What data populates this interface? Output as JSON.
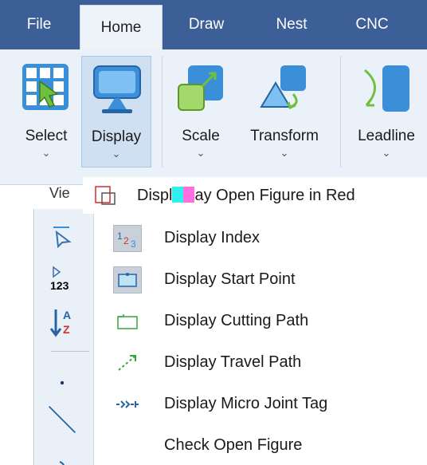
{
  "tabs": [
    {
      "label": "File",
      "active": false
    },
    {
      "label": "Home",
      "active": true
    },
    {
      "label": "Draw",
      "active": false
    },
    {
      "label": "Nest",
      "active": false
    },
    {
      "label": "CNC",
      "active": false
    }
  ],
  "ribbon": {
    "buttons": [
      {
        "label": "Select",
        "icon": "select-grid-icon",
        "chevron": "⌄"
      },
      {
        "label": "Display",
        "icon": "display-monitor-icon",
        "chevron": "⌄",
        "pressed": true
      },
      {
        "label": "Scale",
        "icon": "scale-icon",
        "chevron": "⌄"
      },
      {
        "label": "Transform",
        "icon": "transform-icon",
        "chevron": "⌄"
      },
      {
        "label": "Leadline",
        "icon": "leadline-icon",
        "chevron": "⌄"
      }
    ],
    "group_label": "Vie"
  },
  "menu": {
    "top_item": {
      "text_before": "Displ",
      "text_after": "ay Open Figure in Red",
      "icon": "open-figure-icon"
    },
    "items": [
      {
        "label": "Display Index",
        "icon": "index-numbers-icon",
        "checked": true
      },
      {
        "label": "Display Start Point",
        "icon": "start-point-icon",
        "checked": true
      },
      {
        "label": "Display Cutting Path",
        "icon": "cutting-path-icon",
        "checked": false
      },
      {
        "label": "Display Travel Path",
        "icon": "travel-path-icon",
        "checked": false
      },
      {
        "label": "Display Micro Joint Tag",
        "icon": "micro-joint-icon",
        "checked": false
      },
      {
        "label": "Check Open Figure",
        "icon": "",
        "checked": false
      }
    ],
    "gutter_icons": [
      "pointer-select-icon",
      "sort-123-icon",
      "sort-az-icon",
      "dot-icon",
      "line-icon",
      "arc-icon"
    ],
    "gutter_text": {
      "sort_123": "123",
      "sort_a": "A",
      "sort_z": "Z"
    }
  },
  "colors": {
    "tab_bar": "#3c5f97",
    "ribbon_bg": "#eaf1f9",
    "icon_blue": "#3a8fd8",
    "icon_green": "#35a63b",
    "accent_red": "#d32f2f",
    "highlight_cyan": "#2ef0ec",
    "highlight_pink": "#ff6fe0"
  }
}
